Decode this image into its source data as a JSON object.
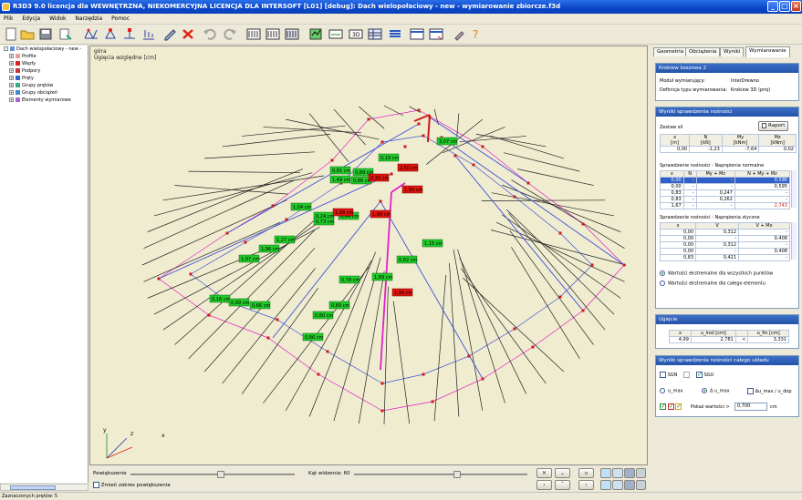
{
  "window": {
    "title": "R3D3 9.0 licencja dla WEWNĘTRZNA, NIEKOMERCYJNA LICENCJA DLA INTERSOFT [L01] [debug]: Dach wielopołaciowy - new - wymiarowanie zbiorcze.f3d"
  },
  "menu": [
    "Plik",
    "Edycja",
    "Widok",
    "Narzędzia",
    "Pomoc"
  ],
  "tree": {
    "root": "Dach wielopołaciowy - new - ",
    "items": [
      "Profile",
      "Węzły",
      "Podpory",
      "Pręty",
      "Grupy prętów",
      "Grupy obciążeń",
      "Elementy wymiarowe"
    ]
  },
  "view": {
    "direction": "góra",
    "subtitle": "Ugięcia względne [cm]",
    "axes": {
      "y": "y",
      "z": "z",
      "x": "x"
    },
    "labels_green": [
      "0,19 cm",
      "3,07 cm",
      "0,81 cm",
      "0,89 cm",
      "1,49 cm",
      "0,86 cm",
      "1,04 cm",
      "0,24 cm",
      "0,84 cm",
      "0,73 cm",
      "1,27 cm",
      "1,96 cm",
      "1,07 cm",
      "1,15 cm",
      "0,82 cm",
      "1,89 cm",
      "0,78 cm",
      "0,16 cm",
      "0,99 cm",
      "0,66 cm",
      "0,89 cm",
      "0,80 cm",
      "0,86 cm"
    ],
    "labels_red": [
      "2,50 cm",
      "2,33 cm",
      "1,99 cm",
      "1,99 cm",
      "1,99 cm",
      "1,99 cm"
    ]
  },
  "bottom": {
    "zoom_label": "Powiększenie",
    "angle_label": "Kąt widzenia: 60",
    "zoom_range_label": "Zmień zakres powiększenia",
    "zoom_value": 0.55,
    "angle_value": 0.6
  },
  "status": "Zaznaczonych prętów: 5",
  "tabs": [
    "Geometria",
    "Obciążenia",
    "Wyniki",
    "Wymiarowanie"
  ],
  "active_tab": "Wymiarowanie",
  "panel": {
    "element_header": "Krokiew koszowa 2",
    "module_label": "Moduł wymiarujący:",
    "module_value": "InterDrewno",
    "def_label": "Definicja typu wymiarowania:",
    "def_value": "Krokiew 3D (proj)",
    "results_header": "Wyniki sprawdzenia nośności",
    "forces_label": "Zestaw sił",
    "raport_button": "Raport",
    "forces_table": {
      "headers": [
        "x\n[m]",
        "N\n[kN]",
        "My\n[kNm]",
        "Mz\n[kNm]"
      ],
      "header_top": [
        "x",
        "N",
        "My",
        "Mz"
      ],
      "header_units": [
        "[m]",
        "[kN]",
        "[kNm]",
        "[kNm]"
      ],
      "row": [
        "0,00",
        "-1,23",
        "-7,64",
        "0,02"
      ]
    },
    "normal_label": "Sprawdzenie nośności - Naprężenia normalne",
    "normal_table": {
      "headers": [
        "x",
        "N",
        "My + Mz",
        "N + My + Mz"
      ],
      "rows": [
        [
          "0,00",
          "-",
          "-",
          "0,596"
        ],
        [
          "0,00",
          "-",
          "-",
          "0,595"
        ],
        [
          "0,83",
          "-",
          "0,247",
          "-"
        ],
        [
          "0,83",
          "-",
          "0,262",
          "-"
        ],
        [
          "1,67",
          "-",
          "-",
          "2,743"
        ]
      ]
    },
    "shear_label": "Sprawdzenie nośności - Naprężenia styczne",
    "shear_table": {
      "headers": [
        "x",
        "V",
        "V + Mx"
      ],
      "rows": [
        [
          "0,00",
          "0,312",
          "-"
        ],
        [
          "0,00",
          "-",
          "0,408"
        ],
        [
          "0,00",
          "0,312",
          "-"
        ],
        [
          "0,00",
          "-",
          "0,408"
        ],
        [
          "0,83",
          "0,421",
          "-"
        ]
      ]
    },
    "radio_all": "Wartości ekstremalne dla wszystkich punktów",
    "radio_element": "Wartości ekstremalne dla całego elementu",
    "deflection_header": "Ugięcie",
    "deflection_table": {
      "headers": [
        "x",
        "u_inst [cm]",
        "",
        "u_fin [cm]"
      ],
      "row": [
        "4,99",
        "2,781",
        "<",
        "3,331"
      ]
    },
    "system_header": "Wyniki sprawdzenia nośności całego układu",
    "sgn": "SGN",
    "sgu": "SGU",
    "umax": "u_max",
    "delta_umax": "Δ u_max",
    "ratio": "Δu_max / u_dop",
    "show_label": "Pokaż wartości >",
    "show_value": "0,700",
    "show_unit": "cm"
  },
  "colors": {
    "accent": "#2553aa",
    "green_label": "#22c92a",
    "red_label": "#e0140e",
    "member_blue": "#3f51d6",
    "member_black": "#222222",
    "member_magenta": "#e020c8"
  }
}
